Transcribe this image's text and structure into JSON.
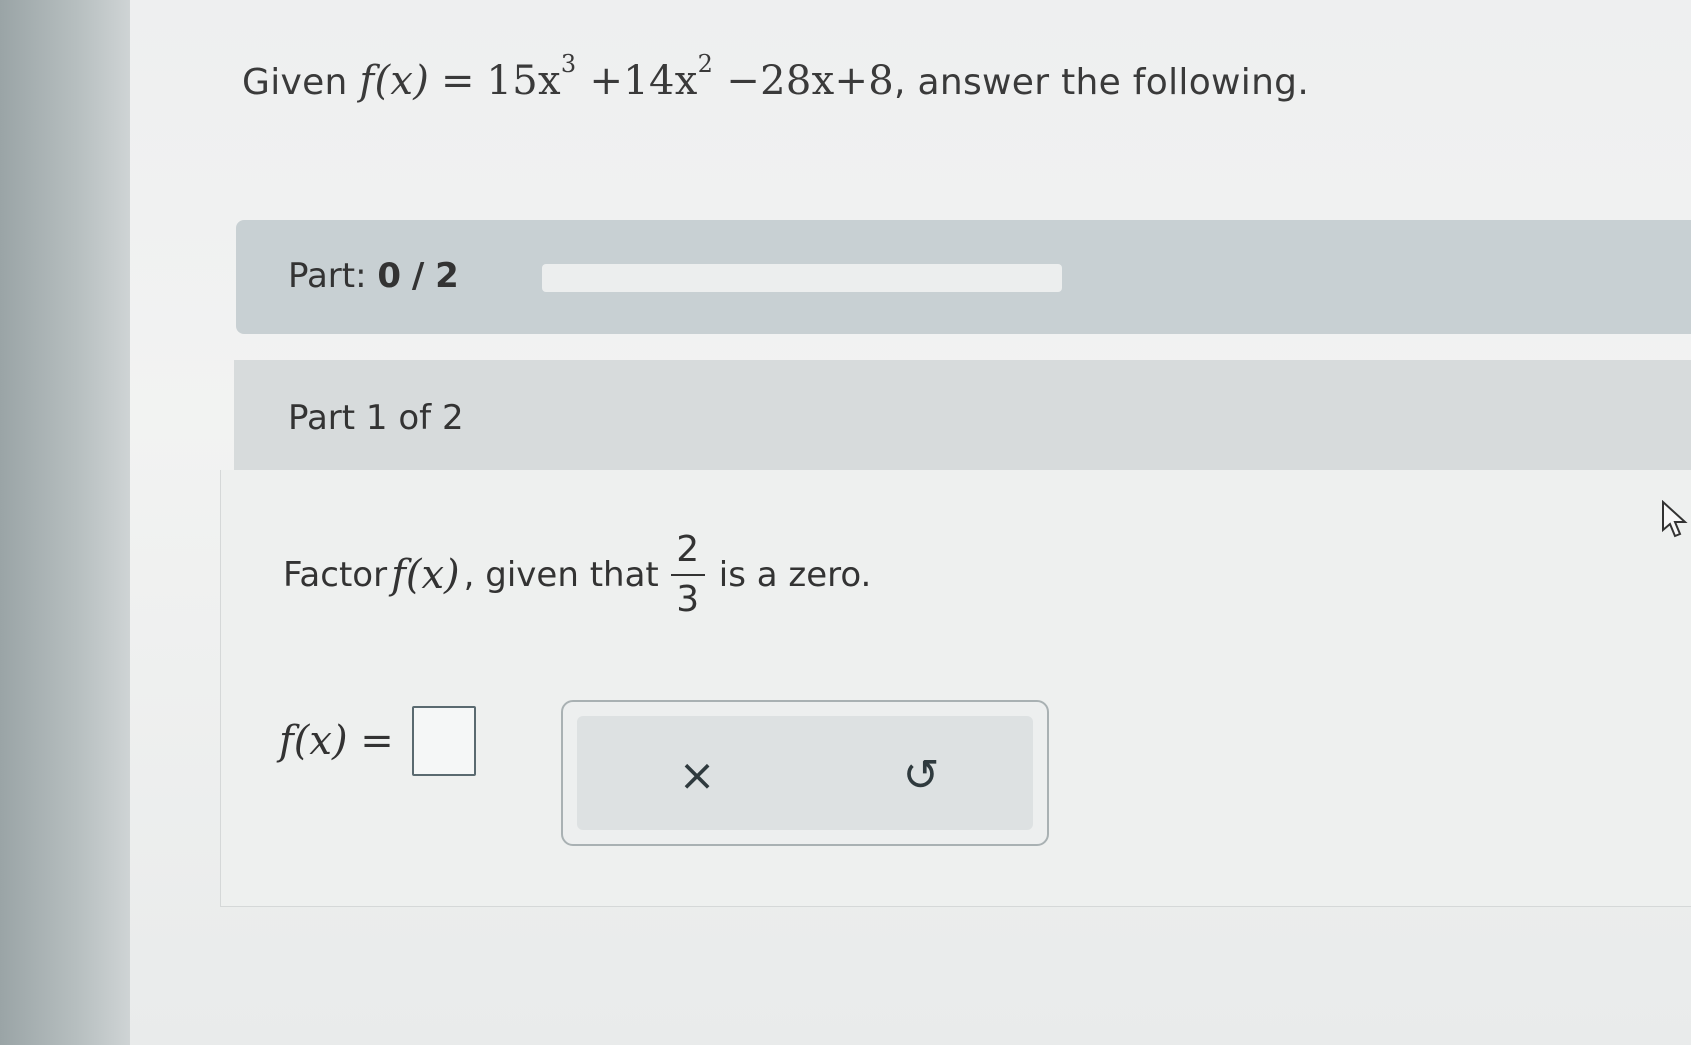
{
  "question": {
    "prefix": "Given",
    "function_lhs": "f(x)",
    "equals": "=",
    "polynomial": {
      "t1_coef": "15x",
      "t1_exp": "3",
      "t2_coef": "+14x",
      "t2_exp": "2",
      "t3": "−28x+8"
    },
    "suffix": ", answer the following."
  },
  "progress": {
    "label": "Part:",
    "current": "0",
    "separator": "/",
    "total": "2",
    "fraction_complete": 0
  },
  "part": {
    "title": "Part 1 of 2",
    "instruction_prefix": "Factor",
    "instruction_func": "f(x)",
    "instruction_mid": ", given that",
    "fraction_num": "2",
    "fraction_den": "3",
    "instruction_suffix": "is a zero.",
    "answer_lhs": "f(x) =",
    "answer_value": ""
  },
  "tools": {
    "clear_icon": "×",
    "undo_icon": "↺"
  }
}
